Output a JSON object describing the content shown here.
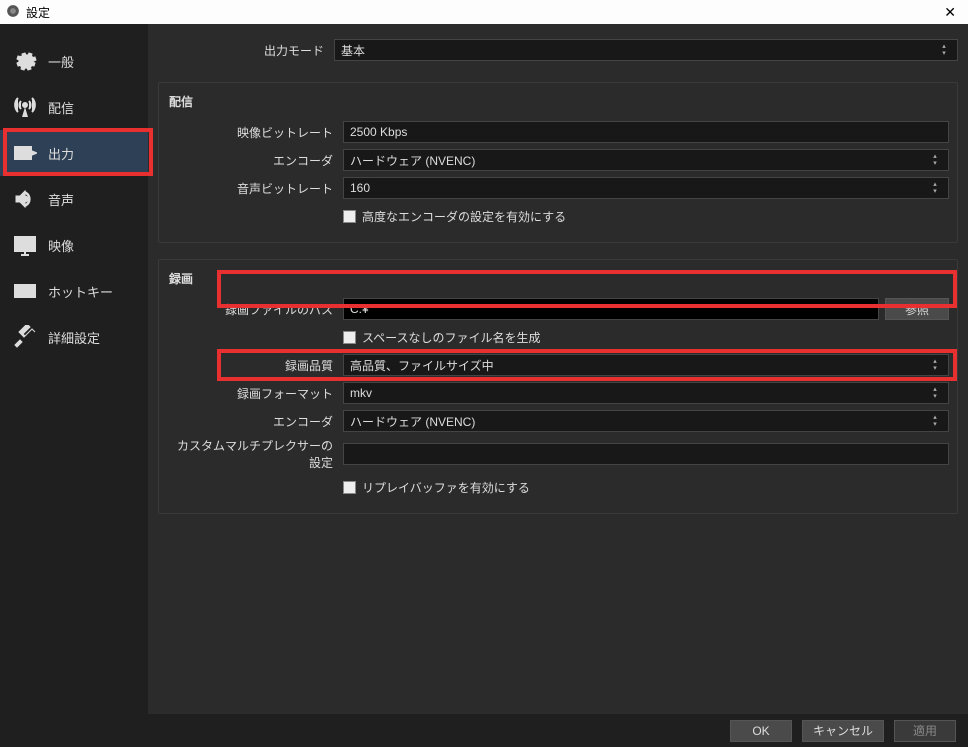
{
  "window": {
    "title": "設定",
    "close": "✕"
  },
  "sidebar": {
    "items": [
      {
        "label": "一般",
        "icon": "gear-icon"
      },
      {
        "label": "配信",
        "icon": "antenna-icon"
      },
      {
        "label": "出力",
        "icon": "output-icon",
        "active": true
      },
      {
        "label": "音声",
        "icon": "speaker-icon"
      },
      {
        "label": "映像",
        "icon": "monitor-icon"
      },
      {
        "label": "ホットキー",
        "icon": "keyboard-icon"
      },
      {
        "label": "詳細設定",
        "icon": "tools-icon"
      }
    ]
  },
  "outputMode": {
    "label": "出力モード",
    "value": "基本"
  },
  "stream": {
    "title": "配信",
    "videoBitrate": {
      "label": "映像ビットレート",
      "value": "2500 Kbps"
    },
    "encoder": {
      "label": "エンコーダ",
      "value": "ハードウェア (NVENC)"
    },
    "audioBitrate": {
      "label": "音声ビットレート",
      "value": "160"
    },
    "advanced": {
      "label": "高度なエンコーダの設定を有効にする",
      "checked": false
    }
  },
  "record": {
    "title": "録画",
    "path": {
      "label": "録画ファイルのパス",
      "value": "C:¥",
      "browse": "参照"
    },
    "noSpaceFilename": {
      "label": "スペースなしのファイル名を生成",
      "checked": false
    },
    "quality": {
      "label": "録画品質",
      "value": "高品質、ファイルサイズ中"
    },
    "format": {
      "label": "録画フォーマット",
      "value": "mkv"
    },
    "encoder": {
      "label": "エンコーダ",
      "value": "ハードウェア (NVENC)"
    },
    "muxer": {
      "label": "カスタムマルチプレクサーの設定",
      "value": ""
    },
    "replayBuffer": {
      "label": "リプレイバッファを有効にする",
      "checked": false
    }
  },
  "footer": {
    "ok": "OK",
    "cancel": "キャンセル",
    "apply": "適用"
  }
}
